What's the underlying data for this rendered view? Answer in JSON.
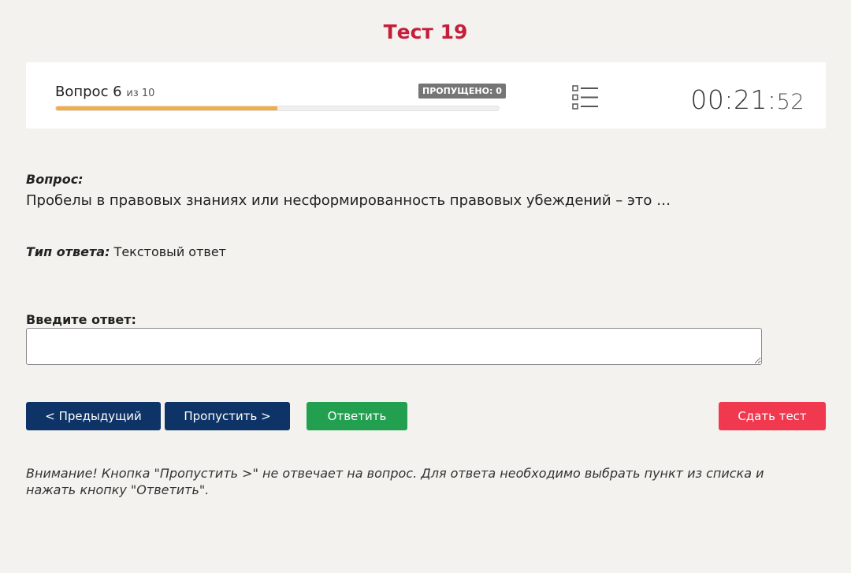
{
  "page": {
    "title": "Тест 19"
  },
  "status": {
    "question_label": "Вопрос 6",
    "question_of": "из 10",
    "skipped_badge": "ПРОПУЩЕНО: 0",
    "progress_fraction": 0.5,
    "timer_main": "00:21:",
    "timer_seconds": "52"
  },
  "question": {
    "label": "Вопрос:",
    "text": "Пробелы в правовых знаниях или несформированность правовых убеждений – это …",
    "answer_type_label": "Тип ответа:",
    "answer_type_value": "Текстовый ответ"
  },
  "answer": {
    "label": "Введите ответ:",
    "value": "",
    "placeholder": ""
  },
  "buttons": {
    "prev": "< Предыдущий",
    "skip": "Пропустить >",
    "answer": "Ответить",
    "finish": "Сдать тест"
  },
  "warning": "Внимание! Кнопка \"Пропустить >\" не отвечает на вопрос. Для ответа необходимо выбрать пункт из списка и нажать кнопку \"Ответить\".",
  "icons": {
    "question_list": "list-icon"
  },
  "colors": {
    "title": "#c41e3a",
    "progress": "#f0ad4e",
    "nav_button": "#0e3467",
    "answer_button": "#22a050",
    "finish_button": "#f0384f",
    "badge": "#757575"
  }
}
